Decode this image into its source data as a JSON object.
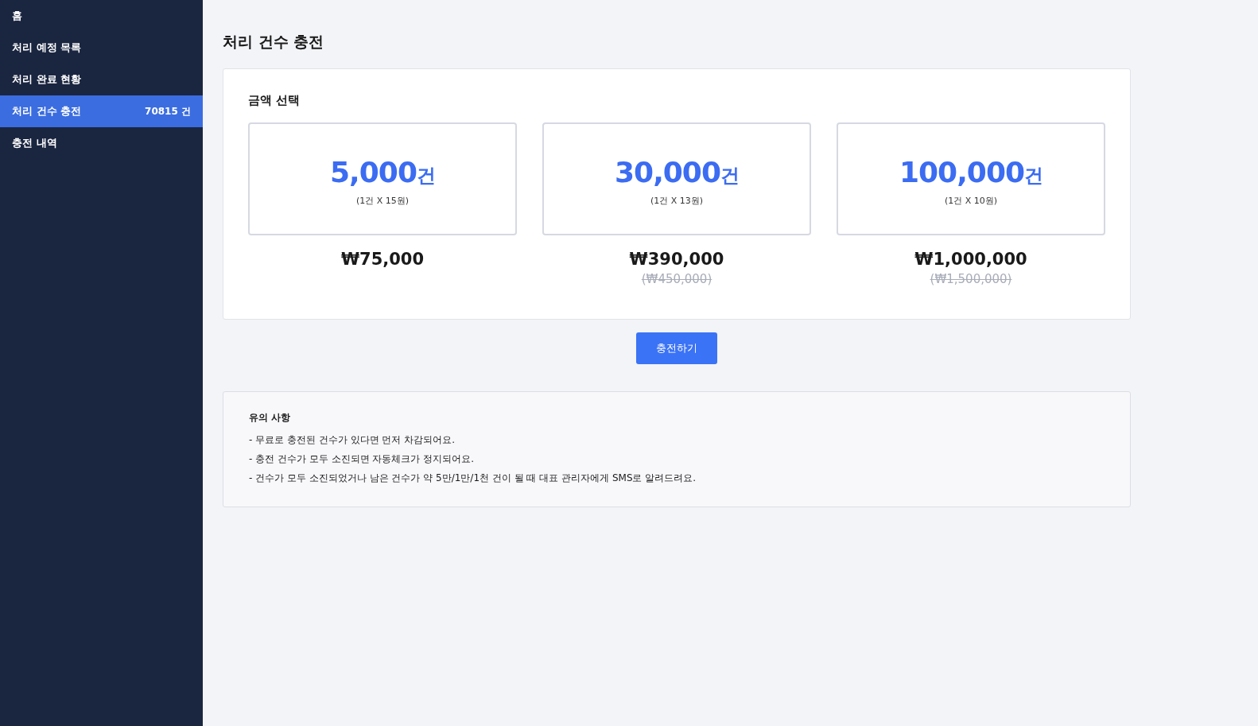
{
  "sidebar": {
    "items": [
      {
        "label": "홈",
        "selected": false
      },
      {
        "label": "처리 예정 목록",
        "selected": false
      },
      {
        "label": "처리 완료 현황",
        "selected": false
      },
      {
        "label": "처리 건수 충전",
        "selected": true,
        "badge": "70815 건"
      },
      {
        "label": "충전 내역",
        "selected": false
      }
    ]
  },
  "page_title": "처리 건수 충전",
  "plan_section": {
    "title": "금액 선택",
    "plans": [
      {
        "count": "5,000",
        "unit": "건",
        "rate": "(1건 X 15원)",
        "price": "₩75,000"
      },
      {
        "count": "30,000",
        "unit": "건",
        "rate": "(1건 X 13원)",
        "price": "₩390,000",
        "original_price": "(₩450,000)"
      },
      {
        "count": "100,000",
        "unit": "건",
        "rate": "(1건 X 10원)",
        "price": "₩1,000,000",
        "original_price": "(₩1,500,000)"
      }
    ]
  },
  "charge_button": "충전하기",
  "notice": {
    "title": "유의 사항",
    "lines": [
      "- 무료로 충전된 건수가 있다면 먼저 차감되어요.",
      "- 충전 건수가 모두 소진되면 자동체크가 정지되어요.",
      "- 건수가 모두 소진되었거나 남은 건수가 약 5만/1만/1천 건이 될 때 대표 관리자에게 SMS로 알려드려요."
    ]
  }
}
